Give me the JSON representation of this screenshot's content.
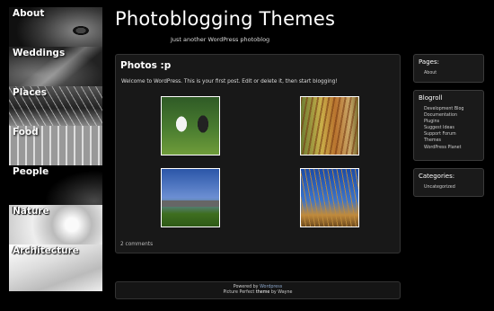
{
  "nav": {
    "items": [
      {
        "label": "About"
      },
      {
        "label": "Weddings"
      },
      {
        "label": "Places"
      },
      {
        "label": "Food"
      },
      {
        "label": "People"
      },
      {
        "label": "Nature"
      },
      {
        "label": "Architecture"
      }
    ]
  },
  "header": {
    "title": "Photoblogging Themes",
    "tagline": "Just another WordPress photoblog"
  },
  "post": {
    "title": "Photos :p",
    "body": "Welcome to WordPress. This is your first post. Edit or delete it, then start blogging!",
    "comments": "2 comments"
  },
  "sidebar": {
    "pages": {
      "title": "Pages:",
      "items": [
        "About"
      ]
    },
    "blogroll": {
      "title": "Blogroll",
      "items": [
        "Development Blog",
        "Documentation",
        "Plugins",
        "Suggest Ideas",
        "Support Forum",
        "Themes",
        "WordPress Planet"
      ]
    },
    "categories": {
      "title": "Categories:",
      "items": [
        "Uncategorized"
      ]
    }
  },
  "footer": {
    "powered_by": "Powered by",
    "powered_link": "Wordpress",
    "theme_prefix": "Picture Perfect",
    "theme_word": "theme",
    "theme_by": "by",
    "theme_author": "Wayne"
  },
  "colors": {
    "background": "#000000",
    "panel": "#181818",
    "border": "#333333",
    "link": "#8aa4c8"
  }
}
